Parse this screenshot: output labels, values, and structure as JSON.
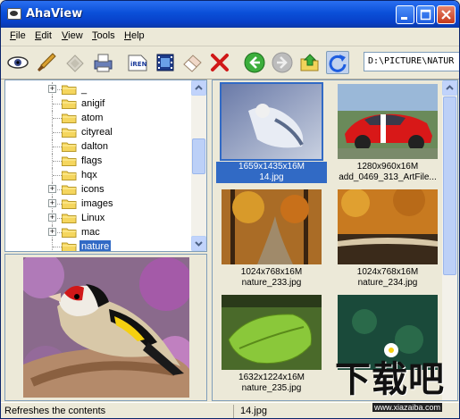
{
  "window": {
    "title": "AhaView"
  },
  "menu": [
    "File",
    "Edit",
    "View",
    "Tools",
    "Help"
  ],
  "menu_accel": [
    "F",
    "E",
    "V",
    "T",
    "H"
  ],
  "toolbar": {
    "tools": [
      "eye-icon",
      "brush-icon",
      "eraser-icon",
      "printer-icon",
      "rename-icon",
      "filmstrip-icon",
      "erase-icon",
      "delete-icon",
      "back-icon",
      "forward-icon",
      "up-folder-icon",
      "refresh-icon"
    ],
    "path": "D:\\PICTURE\\NATUR"
  },
  "tree": {
    "items": [
      {
        "label": "_",
        "expander": "+"
      },
      {
        "label": "anigif",
        "expander": ""
      },
      {
        "label": "atom",
        "expander": ""
      },
      {
        "label": "cityreal",
        "expander": ""
      },
      {
        "label": "dalton",
        "expander": ""
      },
      {
        "label": "flags",
        "expander": ""
      },
      {
        "label": "hqx",
        "expander": ""
      },
      {
        "label": "icons",
        "expander": "+"
      },
      {
        "label": "images",
        "expander": "+"
      },
      {
        "label": "Linux",
        "expander": "+"
      },
      {
        "label": "mac",
        "expander": "+"
      },
      {
        "label": "nature",
        "expander": ""
      }
    ],
    "selected": "nature"
  },
  "thumbnails": [
    {
      "dims": "1659x1435x16M",
      "name": "14.jpg",
      "selected": true
    },
    {
      "dims": "1280x960x16M",
      "name": "add_0469_313_ArtFile...",
      "selected": false
    },
    {
      "dims": "1024x768x16M",
      "name": "nature_233.jpg",
      "selected": false
    },
    {
      "dims": "1024x768x16M",
      "name": "nature_234.jpg",
      "selected": false
    },
    {
      "dims": "1632x1224x16M",
      "name": "nature_235.jpg",
      "selected": false
    },
    {
      "dims": "",
      "name": "",
      "selected": false
    }
  ],
  "status": {
    "message": "Refreshes the contents",
    "file": "14.jpg"
  },
  "watermark": {
    "brand": "下载吧",
    "url": "www.xiazaiba.com"
  }
}
